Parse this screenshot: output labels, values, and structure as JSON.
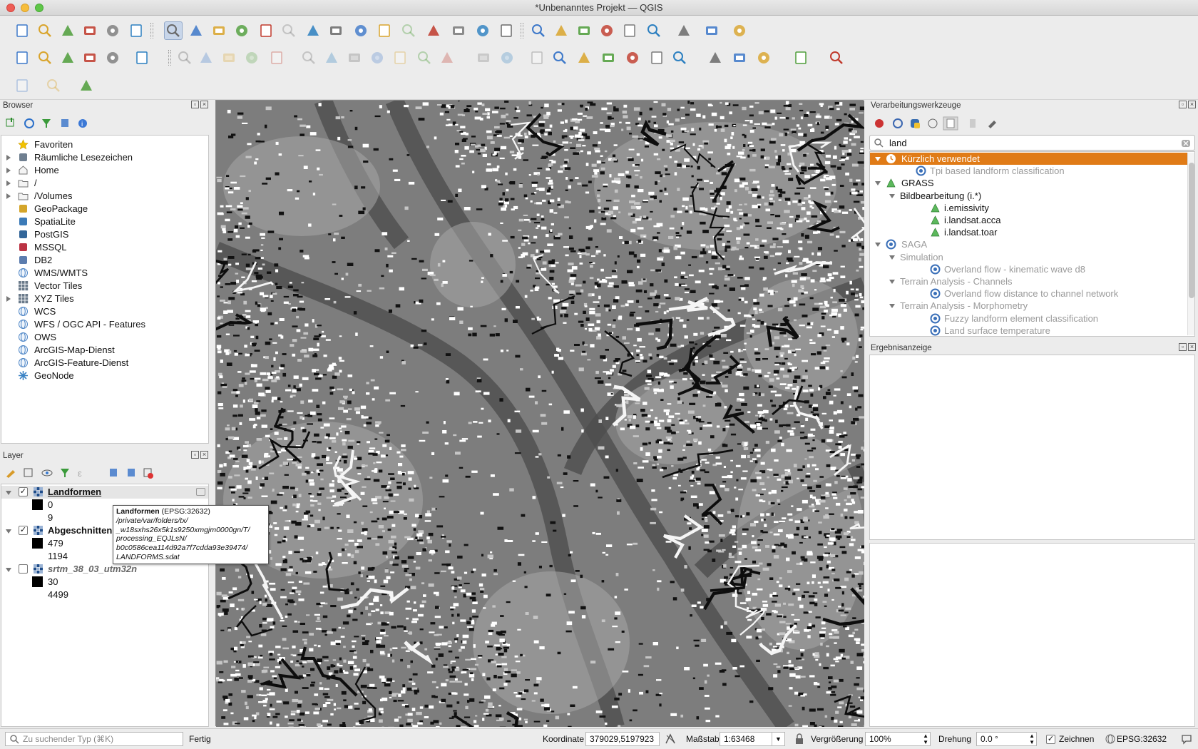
{
  "window": {
    "title": "*Unbenanntes Projekt — QGIS"
  },
  "toolbar": {
    "rows": 3,
    "icons": [
      "new-project",
      "open-project",
      "save-project",
      "save-as",
      "print-layout",
      "style-manager",
      "pan",
      "pan-to-selection",
      "zoom-in",
      "zoom-out",
      "zoom-full",
      "zoom-selection",
      "zoom-layer",
      "zoom-native",
      "zoom-last",
      "zoom-next",
      "new-bookmark",
      "show-bookmarks",
      "temporal",
      "refresh",
      "identify",
      "attribute-table",
      "field-calculator",
      "processing",
      "statistics",
      "measure",
      "map-tips",
      "select",
      "text-annotation"
    ]
  },
  "browser": {
    "title": "Browser",
    "items": [
      {
        "label": "Favoriten",
        "icon": "star-icon",
        "expandable": false
      },
      {
        "label": "Räumliche Lesezeichen",
        "icon": "bookmark-icon",
        "expandable": true
      },
      {
        "label": "Home",
        "icon": "home-icon",
        "expandable": true
      },
      {
        "label": "/",
        "icon": "folder-icon",
        "expandable": true
      },
      {
        "label": "/Volumes",
        "icon": "folder-icon",
        "expandable": true
      },
      {
        "label": "GeoPackage",
        "icon": "geopackage-icon",
        "expandable": false
      },
      {
        "label": "SpatiaLite",
        "icon": "spatialite-icon",
        "expandable": false
      },
      {
        "label": "PostGIS",
        "icon": "postgis-icon",
        "expandable": false
      },
      {
        "label": "MSSQL",
        "icon": "mssql-icon",
        "expandable": false
      },
      {
        "label": "DB2",
        "icon": "db2-icon",
        "expandable": false
      },
      {
        "label": "WMS/WMTS",
        "icon": "globe-icon",
        "expandable": false
      },
      {
        "label": "Vector Tiles",
        "icon": "grid-icon",
        "expandable": false
      },
      {
        "label": "XYZ Tiles",
        "icon": "grid-icon",
        "expandable": true
      },
      {
        "label": "WCS",
        "icon": "globe-icon",
        "expandable": false
      },
      {
        "label": "WFS / OGC API - Features",
        "icon": "globe-icon",
        "expandable": false
      },
      {
        "label": "OWS",
        "icon": "globe-icon",
        "expandable": false
      },
      {
        "label": "ArcGIS-Map-Dienst",
        "icon": "globe-icon",
        "expandable": false
      },
      {
        "label": "ArcGIS-Feature-Dienst",
        "icon": "globe-icon",
        "expandable": false
      },
      {
        "label": "GeoNode",
        "icon": "geonode-icon",
        "expandable": false
      }
    ]
  },
  "layers": {
    "title": "Layer",
    "items": [
      {
        "name": "Landformen",
        "checked": true,
        "bold": true,
        "underline": true,
        "min": "0",
        "max": "9"
      },
      {
        "name": "Abgeschnitten",
        "checked": true,
        "bold": true,
        "underline": false,
        "min": "479",
        "max": "1194"
      },
      {
        "name": "srtm_38_03_utm32n",
        "checked": false,
        "bold": true,
        "underline": false,
        "italic": true,
        "min": "30",
        "max": "4499"
      }
    ],
    "tooltip": {
      "name": "Landformen",
      "crs": "(EPSG:32632)",
      "path": [
        "/private/var/folders/tx/",
        "_w18sxhs26x5k1s9250xmgjm0000gn/T/",
        "processing_EQJLsN/",
        "b0c0586cea114d92a7f7cdda93e39474/",
        "LANDFORMS.sdat"
      ]
    }
  },
  "processing": {
    "title": "Verarbeitungswerkzeuge",
    "search": "land",
    "tree": [
      {
        "label": "Kürzlich verwendet",
        "level": 0,
        "icon": "clock-icon",
        "selected": true,
        "expanded": true,
        "dim": false
      },
      {
        "label": "Tpi based landform classification",
        "level": 1,
        "icon": "saga-icon",
        "dim": true
      },
      {
        "label": "GRASS",
        "level": 0,
        "icon": "grass-icon",
        "expanded": true,
        "dim": false
      },
      {
        "label": "Bildbearbeitung (i.*)",
        "level": 1,
        "icon": "",
        "expanded": true,
        "dim": false
      },
      {
        "label": "i.emissivity",
        "level": 2,
        "icon": "grass-icon",
        "dim": false
      },
      {
        "label": "i.landsat.acca",
        "level": 2,
        "icon": "grass-icon",
        "dim": false
      },
      {
        "label": "i.landsat.toar",
        "level": 2,
        "icon": "grass-icon",
        "dim": false
      },
      {
        "label": "SAGA",
        "level": 0,
        "icon": "saga-icon",
        "expanded": true,
        "dim": true
      },
      {
        "label": "Simulation",
        "level": 1,
        "icon": "",
        "expanded": true,
        "dim": true
      },
      {
        "label": "Overland flow - kinematic wave d8",
        "level": 2,
        "icon": "saga-icon",
        "dim": true
      },
      {
        "label": "Terrain Analysis - Channels",
        "level": 1,
        "icon": "",
        "expanded": true,
        "dim": true
      },
      {
        "label": "Overland flow distance to channel network",
        "level": 2,
        "icon": "saga-icon",
        "dim": true
      },
      {
        "label": "Terrain Analysis - Morphometry",
        "level": 1,
        "icon": "",
        "expanded": true,
        "dim": true
      },
      {
        "label": "Fuzzy landform element classification",
        "level": 2,
        "icon": "saga-icon",
        "dim": true
      },
      {
        "label": "Land surface temperature",
        "level": 2,
        "icon": "saga-icon",
        "dim": true
      }
    ]
  },
  "results": {
    "title": "Ergebnisanzeige"
  },
  "status": {
    "locator_placeholder": "Zu suchender Typ (⌘K)",
    "message": "Fertig",
    "coord_label": "Koordinate",
    "coord_value": "379029,5197923",
    "scale_label": "Maßstab",
    "scale_value": "1:63468",
    "mag_label": "Vergrößerung",
    "mag_value": "100%",
    "rot_label": "Drehung",
    "rot_value": "0.0 °",
    "render_label": "Zeichnen",
    "crs": "EPSG:32632"
  },
  "colors": {
    "selection": "#e07b17",
    "map_mid": "#7d7d7d",
    "map_dark": "#4e4e4e",
    "map_light": "#a8a8a8"
  }
}
